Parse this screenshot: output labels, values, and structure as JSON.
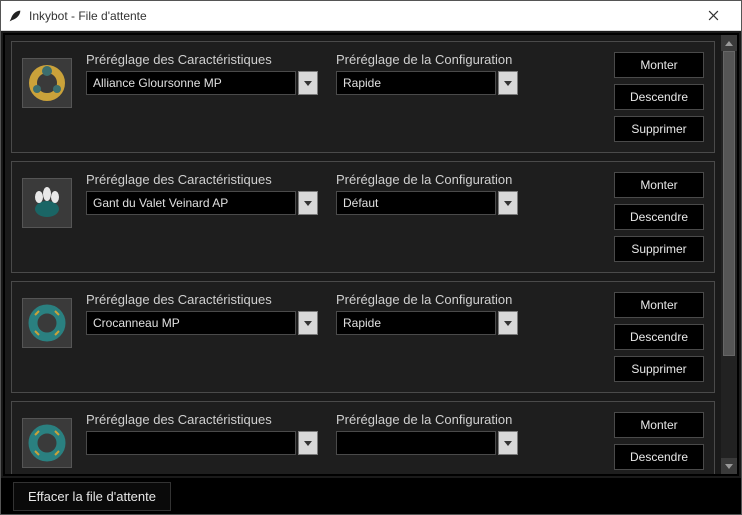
{
  "window": {
    "title": "Inkybot - File d'attente"
  },
  "labels": {
    "char_preset": "Préréglage des Caractéristiques",
    "conf_preset": "Préréglage de la Configuration",
    "up": "Monter",
    "down": "Descendre",
    "delete": "Supprimer",
    "clear_queue": "Effacer la file d'attente"
  },
  "queue": [
    {
      "char_value": "Alliance Gloursonne MP",
      "conf_value": "Rapide",
      "icon_variant": "gold-ring"
    },
    {
      "char_value": "Gant du Valet Veinard AP",
      "conf_value": "Défaut",
      "icon_variant": "claw"
    },
    {
      "char_value": "Crocanneau MP",
      "conf_value": "Rapide",
      "icon_variant": "teal-ring"
    },
    {
      "char_value": "",
      "conf_value": "",
      "icon_variant": "teal-ring"
    }
  ]
}
